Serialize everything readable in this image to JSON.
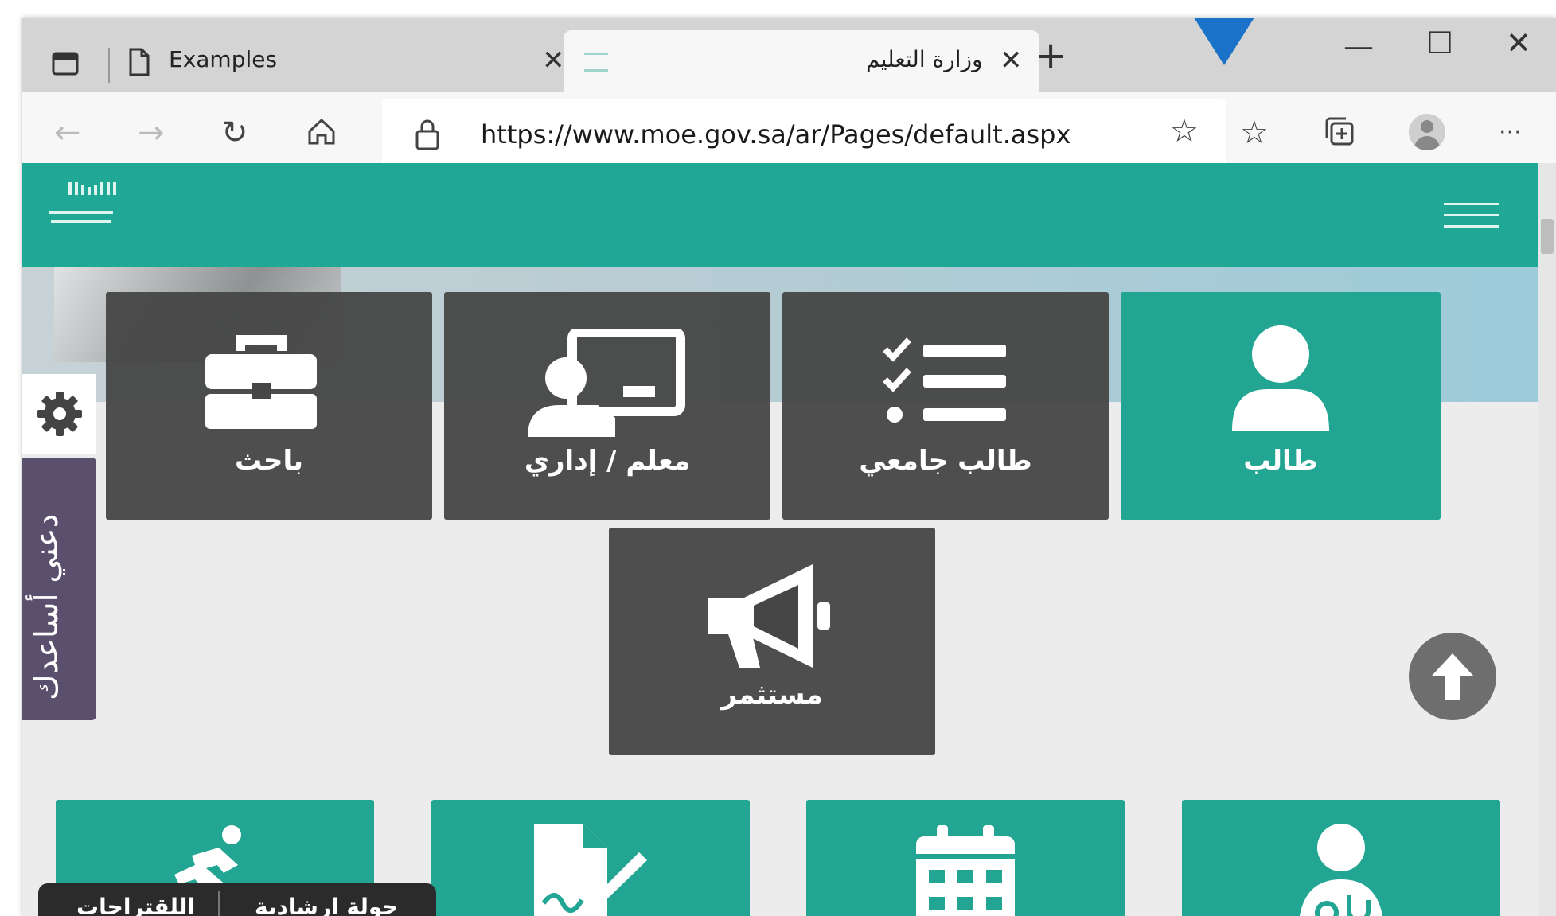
{
  "browser": {
    "tabs": [
      {
        "label": "Examples",
        "active": false
      },
      {
        "label": "وزارة التعليم",
        "active": true
      }
    ],
    "new_tab_symbol": "+",
    "window_controls": {
      "minimize": "—",
      "maximize": "☐",
      "close": "✕"
    },
    "tab_close_symbol": "✕",
    "url": "https://www.moe.gov.sa/ar/Pages/default.aspx",
    "menu_symbol": "···"
  },
  "site": {
    "accent_color": "#1fa896",
    "tiles_top": [
      {
        "label": "طالب",
        "icon": "user-icon",
        "style": "green"
      },
      {
        "label": "طالب جامعي",
        "icon": "checklist-icon",
        "style": "dark"
      },
      {
        "label": "معلم / إداري",
        "icon": "teacher-board-icon",
        "style": "dark"
      },
      {
        "label": "باحث",
        "icon": "briefcase-icon",
        "style": "dark"
      }
    ],
    "tile_center": {
      "label": "مستثمر",
      "icon": "megaphone-icon"
    },
    "tiles_bottom": [
      {
        "icon": "running-person-icon"
      },
      {
        "icon": "document-sign-icon"
      },
      {
        "icon": "calendar-icon"
      },
      {
        "icon": "doctor-icon"
      }
    ],
    "help_tab": "دعني أساعدك",
    "bottom_bar": {
      "tour": "جولة ارشادية",
      "suggestions": "اللقتراحات"
    }
  }
}
